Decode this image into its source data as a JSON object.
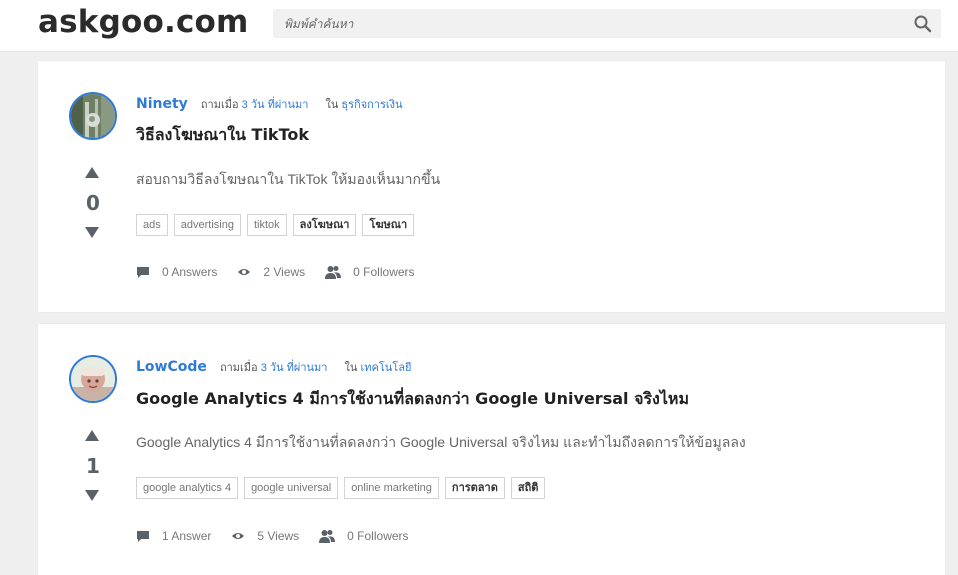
{
  "site": {
    "logo": "askgoo.com",
    "search_placeholder": "พิมพ์คำค้นหา"
  },
  "posts": [
    {
      "author": "Ninety",
      "asked_prefix": "ถามเมื่อ",
      "asked_time": "3 วัน ที่ผ่านมา",
      "in_prefix": "ใน",
      "category": "ธุรกิจการเงิน",
      "title": "วิธีลงโฆษณาใน TikTok",
      "excerpt": "สอบถามวิธีลงโฆษณาใน TikTok ให้มองเห็นมากขึ้น",
      "votes": "0",
      "tags": [
        "ads",
        "advertising",
        "tiktok",
        "ลงโฆษณา",
        "โฆษณา"
      ],
      "answers": "0 Answers",
      "views": "2 Views",
      "followers": "0 Followers"
    },
    {
      "author": "LowCode",
      "asked_prefix": "ถามเมื่อ",
      "asked_time": "3 วัน ที่ผ่านมา",
      "in_prefix": "ใน",
      "category": "เทคโนโลยี",
      "title": "Google Analytics 4 มีการใช้งานที่ลดลงกว่า Google Universal จริงไหม",
      "excerpt": "Google Analytics 4 มีการใช้งานที่ลดลงกว่า Google Universal จริงไหม และทำไมถึงลดการให้ข้อมูลลง",
      "votes": "1",
      "tags": [
        "google analytics 4",
        "google universal",
        "online marketing",
        "การตลาด",
        "สถิติ"
      ],
      "answers": "1 Answer",
      "views": "5 Views",
      "followers": "0 Followers"
    }
  ],
  "colors": {
    "link": "#2f7ad6",
    "text": "#333333",
    "muted": "#777777",
    "vote": "#5b6169"
  }
}
